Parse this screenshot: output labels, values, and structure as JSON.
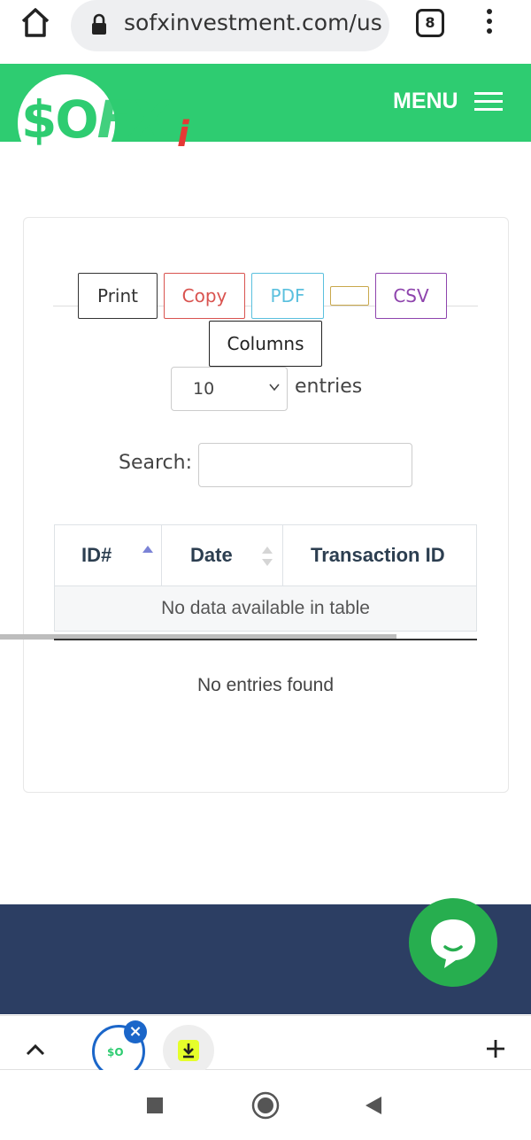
{
  "browser": {
    "url": "sofxinvestment.com/use",
    "tab_count": "8"
  },
  "header": {
    "logo": "$OFXi",
    "menu_label": "MENU"
  },
  "toolbar": {
    "print_label": "Print",
    "copy_label": "Copy",
    "pdf_label": "PDF",
    "excel_label": "",
    "csv_label": "CSV",
    "columns_label": "Columns"
  },
  "length_control": {
    "selected": "10",
    "suffix": "entries"
  },
  "search": {
    "label": "Search:",
    "value": ""
  },
  "table": {
    "columns": [
      "ID#",
      "Date",
      "Transaction ID"
    ],
    "empty_message": "No data available in table"
  },
  "info": "No entries found",
  "tabstrip": {
    "tab_thumb_text": "$O"
  },
  "colors": {
    "brand_green": "#2ecc71",
    "footer_navy": "#2c3e63",
    "chat_green": "#27ae4f"
  }
}
